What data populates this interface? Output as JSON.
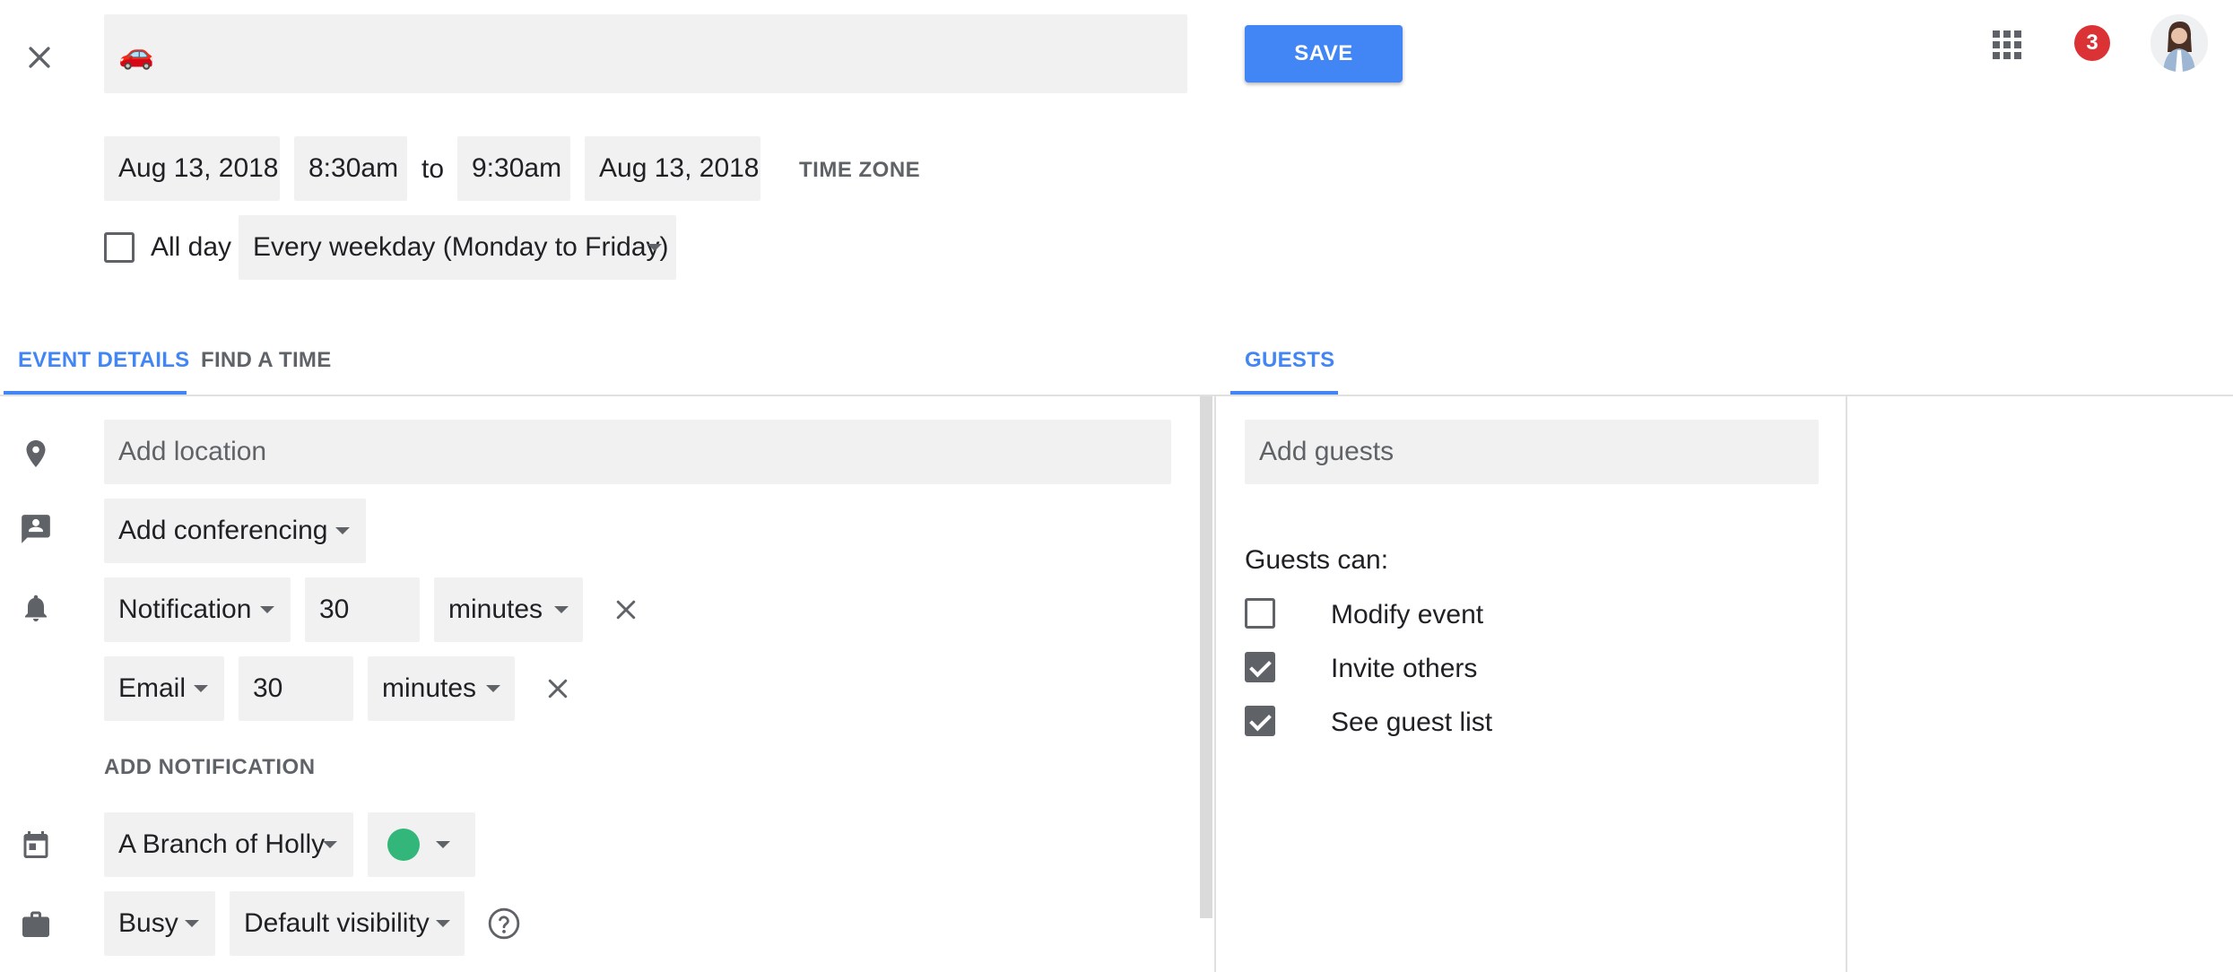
{
  "header": {
    "title_value": "🚗",
    "save_label": "SAVE",
    "notification_count": "3"
  },
  "datetime": {
    "start_date": "Aug 13, 2018",
    "start_time": "8:30am",
    "to_label": "to",
    "end_time": "9:30am",
    "end_date": "Aug 13, 2018",
    "time_zone_label": "TIME ZONE"
  },
  "allday": {
    "label": "All day",
    "checked": false,
    "recurrence": "Every weekday (Monday to Friday)"
  },
  "tabs": {
    "event_details": "EVENT DETAILS",
    "find_a_time": "FIND A TIME",
    "guests": "GUESTS",
    "accent_color": "#4285f4"
  },
  "details": {
    "location_placeholder": "Add location",
    "conferencing": "Add conferencing",
    "notifications": [
      {
        "method": "Notification",
        "amount": "30",
        "unit": "minutes"
      },
      {
        "method": "Email",
        "amount": "30",
        "unit": "minutes"
      }
    ],
    "add_notification": "ADD NOTIFICATION",
    "calendar": "A Branch of Holly",
    "calendar_color": "#33b679",
    "availability": "Busy",
    "visibility": "Default visibility"
  },
  "guests": {
    "placeholder": "Add guests",
    "can_label": "Guests can:",
    "permissions": [
      {
        "label": "Modify event",
        "checked": false
      },
      {
        "label": "Invite others",
        "checked": true
      },
      {
        "label": "See guest list",
        "checked": true
      }
    ]
  }
}
